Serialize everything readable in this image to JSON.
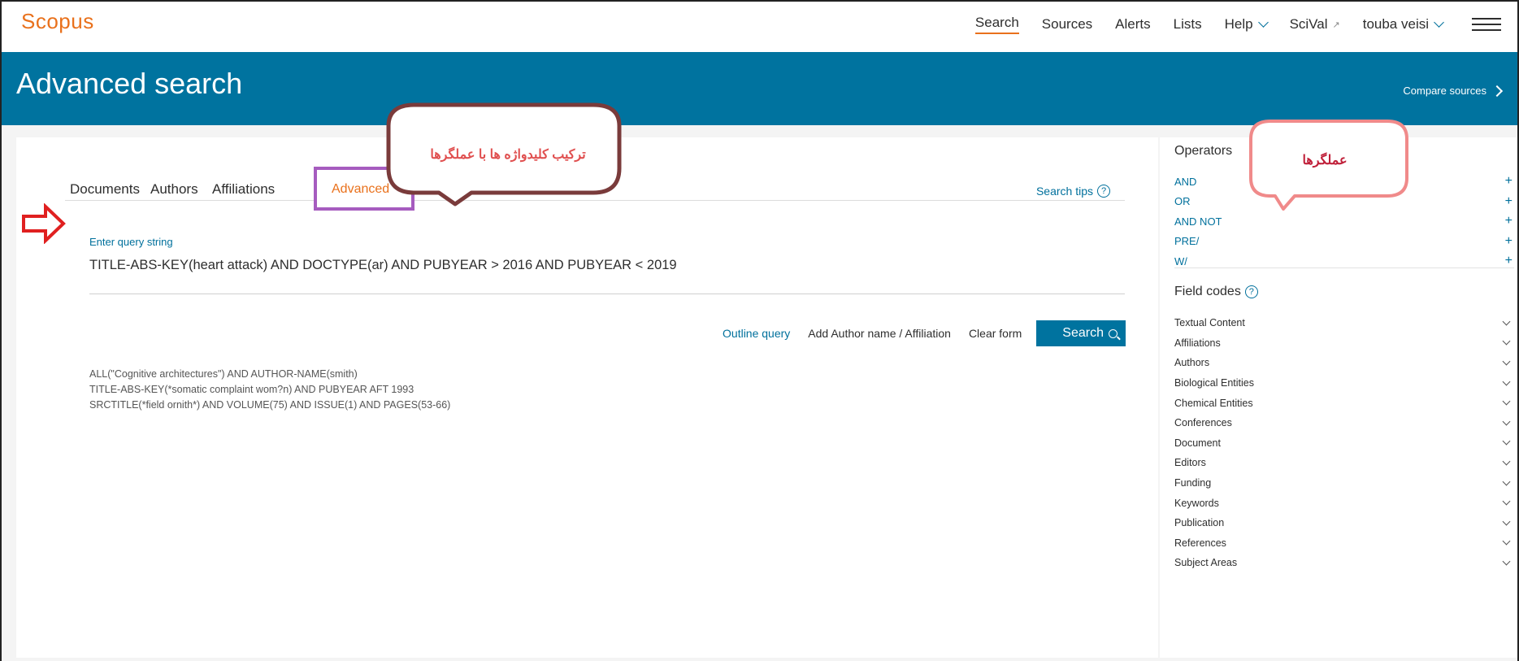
{
  "topnav": {
    "logo": "Scopus",
    "links": {
      "search": "Search",
      "sources": "Sources",
      "alerts": "Alerts",
      "lists": "Lists",
      "help": "Help",
      "scival": "SciVal",
      "scival_icon": "external-link-icon",
      "user": "touba veisi"
    }
  },
  "banner": {
    "title": "Advanced search",
    "compare": "Compare sources"
  },
  "tabs": {
    "documents": "Documents",
    "authors": "Authors",
    "affiliations": "Affiliations",
    "advanced": "Advanced",
    "search_tips": "Search tips"
  },
  "query": {
    "label": "Enter query string",
    "value": "TITLE-ABS-KEY(heart attack) AND DOCTYPE(ar) AND PUBYEAR > 2016 AND PUBYEAR < 2019"
  },
  "actions": {
    "outline": "Outline query",
    "add_author": "Add Author name / Affiliation",
    "clear": "Clear form",
    "search": "Search"
  },
  "examples": [
    "ALL(\"Cognitive architectures\") AND AUTHOR-NAME(smith)",
    "TITLE-ABS-KEY(*somatic complaint wom?n) AND PUBYEAR AFT 1993",
    "SRCTITLE(*field ornith*) AND VOLUME(75) AND ISSUE(1) AND PAGES(53-66)"
  ],
  "annotations": {
    "brown_callout": "ترکیب کلیدواژه ها با عملگرها",
    "pink_callout": "عملگرها"
  },
  "operators": {
    "title": "Operators",
    "items": [
      "AND",
      "OR",
      "AND NOT",
      "PRE/",
      "W/"
    ]
  },
  "field_codes": {
    "title": "Field codes",
    "items": [
      "Textual Content",
      "Affiliations",
      "Authors",
      "Biological Entities",
      "Chemical Entities",
      "Conferences",
      "Document",
      "Editors",
      "Funding",
      "Keywords",
      "Publication",
      "References",
      "Subject Areas"
    ]
  },
  "colors": {
    "brand_orange": "#e9711c",
    "banner_blue": "#00739f",
    "link_blue": "#00709c",
    "advanced_highlight": "#a65cbf",
    "callout_brown": "#7a3b3b",
    "callout_pink": "#f08a8a",
    "arrow_red": "#e02020"
  }
}
